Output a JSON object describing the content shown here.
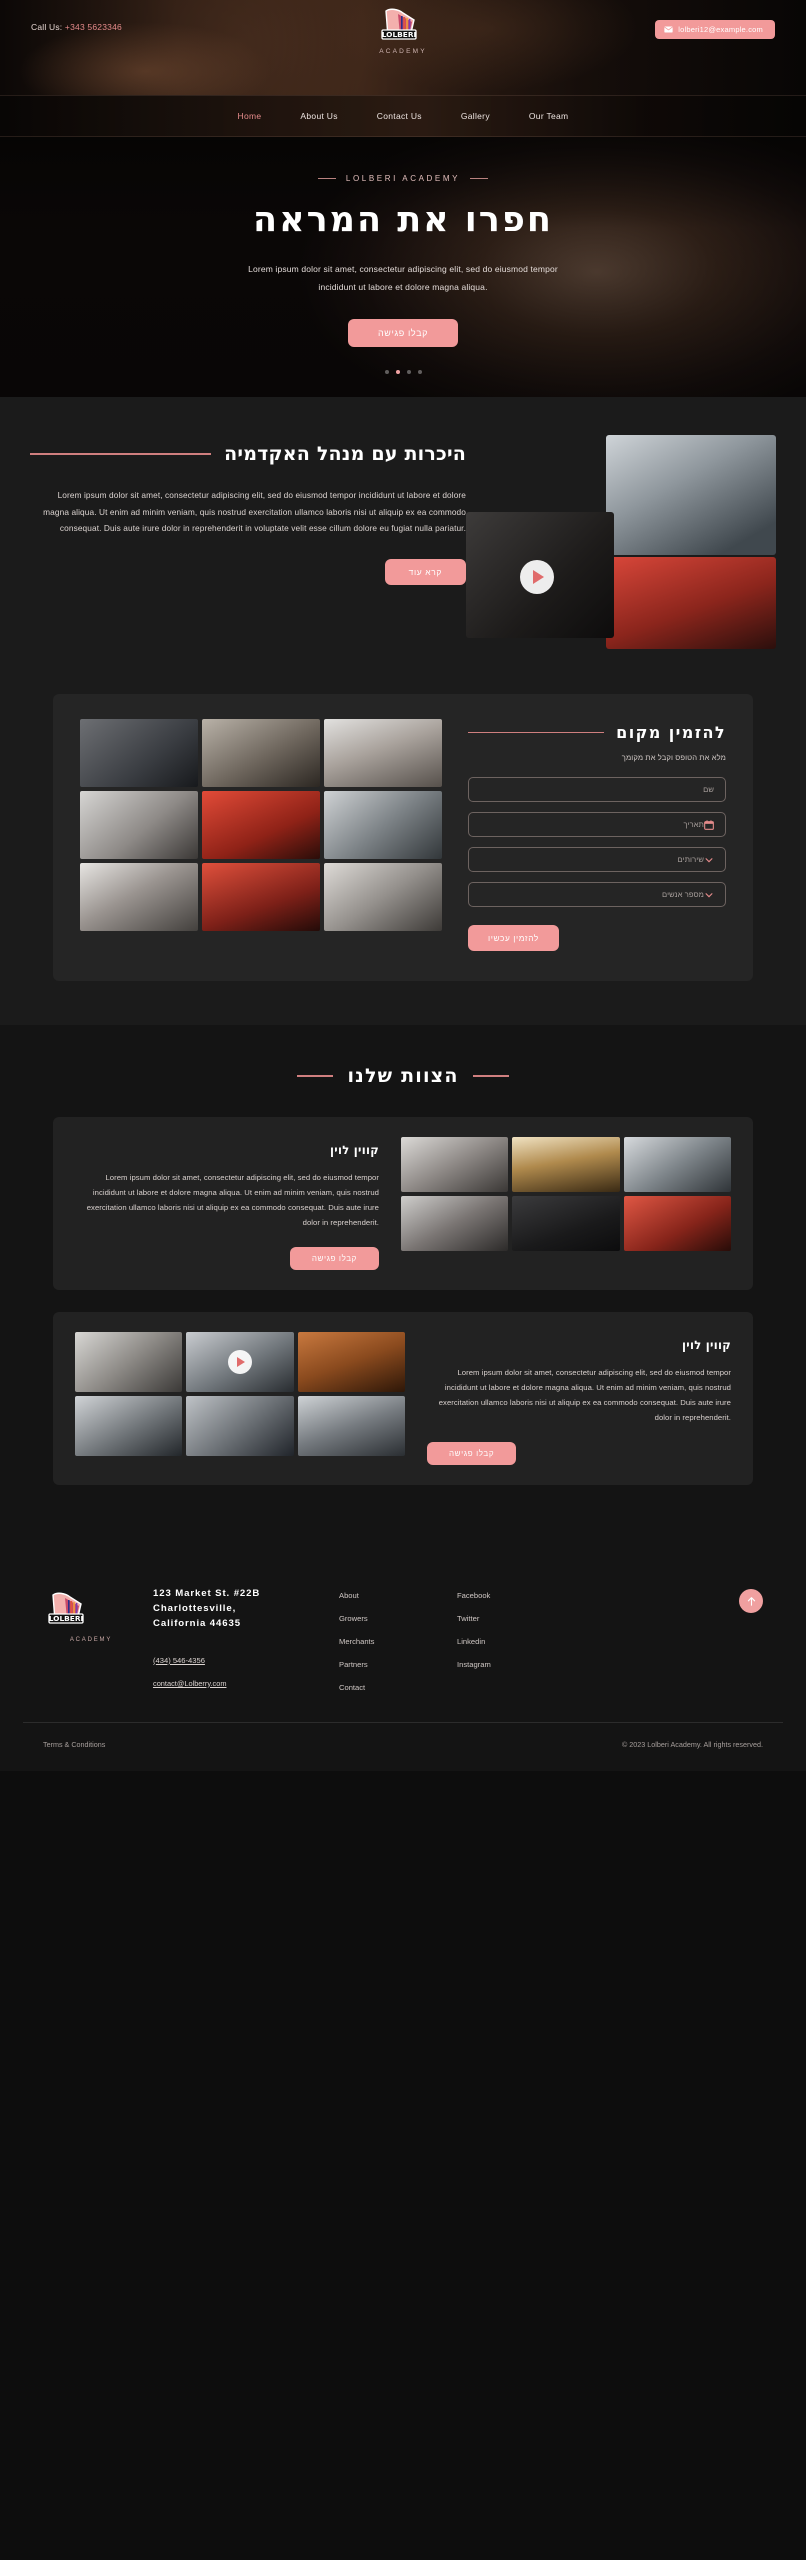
{
  "brand": {
    "name": "LOLBERI",
    "tagline": "ACADEMY",
    "logo_icon": "barber-chair-logo"
  },
  "topbar": {
    "call_label": "Call Us:",
    "phone": "+343 5623346",
    "email": "lolberi12@example.com",
    "mail_icon": "envelope-icon"
  },
  "nav": {
    "items": [
      {
        "label": "Home",
        "active": true
      },
      {
        "label": "About Us",
        "active": false
      },
      {
        "label": "Contact Us",
        "active": false
      },
      {
        "label": "Gallery",
        "active": false
      },
      {
        "label": "Our Team",
        "active": false
      }
    ]
  },
  "hero": {
    "eyebrow": "LOLBERI ACADEMY",
    "title": "חפרו את המראה",
    "subtitle": "Lorem ipsum dolor sit amet, consectetur adipiscing elit, sed do eiusmod tempor incididunt ut labore et dolore magna aliqua.",
    "cta": "קבלו פגישה",
    "slides": 4,
    "active_slide": 2
  },
  "about": {
    "heading": "היכרות עם מנהל האקדמיה",
    "body": "Lorem ipsum dolor sit amet, consectetur adipiscing elit, sed do eiusmod tempor incididunt ut labore et dolore magna aliqua. Ut enim ad minim veniam, quis nostrud exercitation ullamco laboris nisi ut aliquip ex ea commodo consequat. Duis aute irure dolor in reprehenderit in voluptate velit esse cillum dolore eu fugiat nulla pariatur.",
    "cta": "קרא עוד",
    "play_icon": "play-icon"
  },
  "booking": {
    "heading": "להזמין מקום",
    "subtitle": "מלא את הטופס וקבל את מקומך",
    "fields": [
      {
        "label": "שם",
        "icon": "none"
      },
      {
        "label": "תאריך",
        "icon": "calendar-icon"
      },
      {
        "label": "שירותים",
        "icon": "chevron-down-icon"
      },
      {
        "label": "מספר אנשים",
        "icon": "chevron-down-icon"
      }
    ],
    "submit": "להזמין עכשיו"
  },
  "team": {
    "heading": "הצוות שלנו",
    "members": [
      {
        "name": "קווין לוין",
        "bio": "Lorem ipsum dolor sit amet, consectetur adipiscing elit, sed do eiusmod tempor incididunt ut labore et dolore magna aliqua. Ut enim ad minim veniam, quis nostrud exercitation ullamco laboris nisi ut aliquip ex ea commodo consequat. Duis aute irure dolor in reprehenderit.",
        "cta": "קבלו פגישה"
      },
      {
        "name": "קווין לוין",
        "bio": "Lorem ipsum dolor sit amet, consectetur adipiscing elit, sed do eiusmod tempor incididunt ut labore et dolore magna aliqua. Ut enim ad minim veniam, quis nostrud exercitation ullamco laboris nisi ut aliquip ex ea commodo consequat. Duis aute irure dolor in reprehenderit.",
        "cta": "קבלו פגישה"
      }
    ]
  },
  "footer": {
    "address_line1": "123 Market St. #22B",
    "address_line2": "Charlottesville,",
    "address_line3": "California 44635",
    "phone": "(434) 546-4356",
    "email": "contact@Lolberry.com",
    "links": [
      "About",
      "Growers",
      "Merchants",
      "Partners",
      "Contact"
    ],
    "social": [
      "Facebook",
      "Twitter",
      "Linkedin",
      "Instagram"
    ],
    "terms": "Terms & Conditions",
    "copyright": "© 2023 Lolberi Academy. All rights reserved.",
    "to_top_icon": "arrow-up-icon"
  },
  "colors": {
    "accent": "#f29a9a",
    "accent_text": "#e58b8b",
    "page_bg": "#141414",
    "panel_bg": "#222222",
    "about_bg": "#1b1b1b"
  }
}
